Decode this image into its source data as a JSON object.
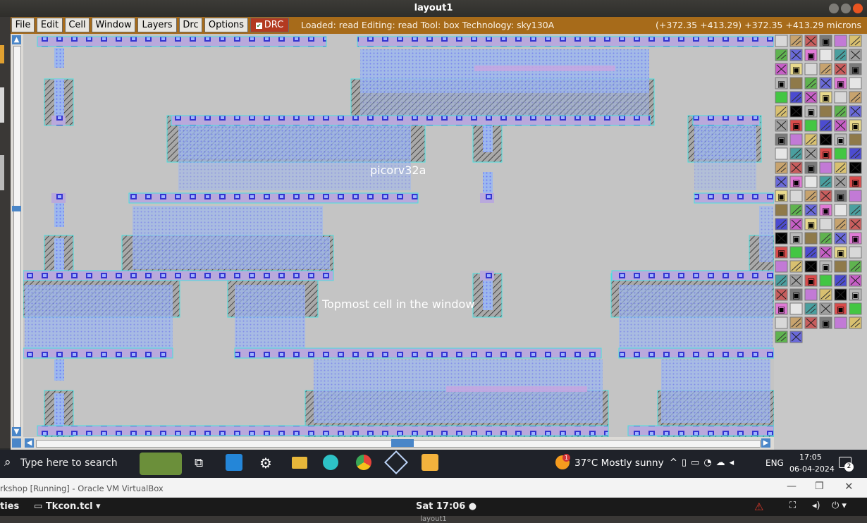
{
  "window": {
    "title": "layout1"
  },
  "menu": {
    "items": [
      "File",
      "Edit",
      "Cell",
      "Window",
      "Layers",
      "Drc",
      "Options"
    ],
    "drc_label": "DRC",
    "status": "Loaded: read Editing: read Tool: box  Technology: sky130A",
    "coords": "(+372.35 +413.29) +372.35 +413.29 microns"
  },
  "canvas": {
    "cell_name": "picorv32a",
    "topmost_label": "Topmost cell in the window"
  },
  "taskbar": {
    "search_placeholder": "Type here to search",
    "weather": "37°C  Mostly sunny",
    "lang": "ENG",
    "time": "17:05",
    "date": "06-04-2024",
    "notif_count": "2",
    "weather_badge": "1"
  },
  "vbox": {
    "title": "rkshop [Running] - Oracle VM VirtualBox"
  },
  "gnome": {
    "activities": "ties",
    "app": "Tkcon.tcl ▾",
    "clock": "Sat 17:06 ●"
  },
  "bottom": {
    "title": "layout1"
  },
  "colors": {
    "menubar": "#a76b1a",
    "canvas": "#c4c4c4",
    "metal": "#7d7dff",
    "hatch": "#555555"
  }
}
